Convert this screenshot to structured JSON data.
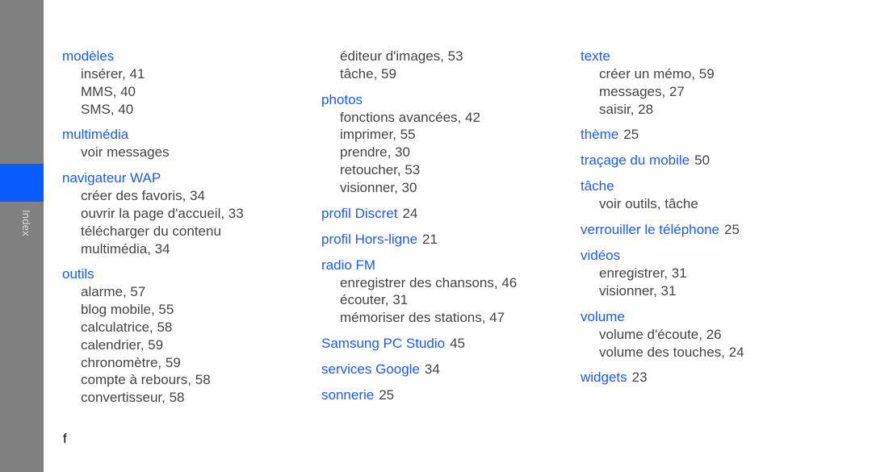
{
  "sidebar": {
    "label": "Index",
    "tab_color": "#0a5cff",
    "bg_color": "#808080"
  },
  "columns": [
    {
      "continuation": [],
      "entries": [
        {
          "term": "modèles",
          "page": "",
          "subs": [
            "insérer,  41",
            "MMS,  40",
            "SMS,  40"
          ]
        },
        {
          "term": "multimédia",
          "page": "",
          "subs": [
            "voir messages"
          ]
        },
        {
          "term": "navigateur WAP",
          "page": "",
          "subs": [
            "créer des favoris,  34",
            "ouvrir la page d'accueil,  33",
            "télécharger du contenu",
            "multimédia,  34"
          ]
        },
        {
          "term": "outils",
          "page": "",
          "subs": [
            "alarme,  57",
            "blog mobile,  55",
            "calculatrice,  58",
            "calendrier,  59",
            "chronomètre,  59",
            "compte à rebours,  58",
            "convertisseur,  58"
          ]
        }
      ]
    },
    {
      "continuation": [
        "éditeur d'images,  53",
        "tâche,  59"
      ],
      "entries": [
        {
          "term": "photos",
          "page": "",
          "subs": [
            "fonctions avancées,  42",
            "imprimer,  55",
            "prendre,  30",
            "retoucher,  53",
            "visionner,  30"
          ]
        },
        {
          "term": "profil Discret",
          "page": "24",
          "subs": []
        },
        {
          "term": "profil Hors-ligne",
          "page": "21",
          "subs": []
        },
        {
          "term": "radio FM",
          "page": "",
          "subs": [
            "enregistrer des chansons,  46",
            "écouter,  31",
            "mémoriser des stations,  47"
          ]
        },
        {
          "term": "Samsung PC Studio",
          "page": "45",
          "subs": []
        },
        {
          "term": "services Google",
          "page": "34",
          "subs": []
        },
        {
          "term": "sonnerie",
          "page": "25",
          "subs": []
        }
      ]
    },
    {
      "continuation": [],
      "entries": [
        {
          "term": "texte",
          "page": "",
          "subs": [
            "créer un mémo,  59",
            "messages,  27",
            "saisir,  28"
          ]
        },
        {
          "term": "thème",
          "page": "25",
          "subs": []
        },
        {
          "term": "traçage du mobile",
          "page": "50",
          "subs": []
        },
        {
          "term": "tâche",
          "page": "",
          "subs": [
            "voir outils, tâche"
          ]
        },
        {
          "term": "verrouiller le téléphone",
          "page": "25",
          "subs": []
        },
        {
          "term": "vidéos",
          "page": "",
          "subs": [
            "enregistrer,  31",
            "visionner,  31"
          ]
        },
        {
          "term": "volume",
          "page": "",
          "subs": [
            "volume d'écoute,  26",
            "volume des touches,  24"
          ]
        },
        {
          "term": "widgets",
          "page": "23",
          "subs": []
        }
      ]
    }
  ],
  "footer": {
    "letter": "f"
  }
}
